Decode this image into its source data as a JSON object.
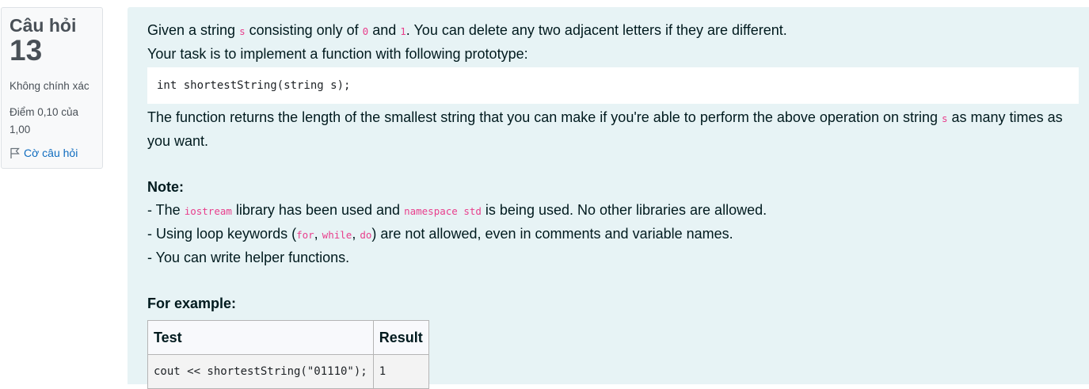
{
  "question_info": {
    "label": "Câu hỏi",
    "number": "13",
    "state": "Không chính xác",
    "grade": "Điểm 0,10 của 1,00",
    "flag_label": "Cờ câu hỏi",
    "flag_icon": "flag-icon"
  },
  "question_text": {
    "line1": {
      "t1": "Given a string ",
      "c1": "s",
      "t2": " consisting only of ",
      "c2": "0",
      "t3": " and ",
      "c3": "1",
      "t4": ". You can delete any two adjacent letters if they are different."
    },
    "line2": "Your task is to implement a function with following prototype:",
    "prototype": "int shortestString(string s);",
    "line3": {
      "t1": "The function returns the length of the smallest string that you can make if you're able to perform the above operation on string ",
      "c1": "s",
      "t2": " as many times as you want."
    },
    "note_title": "Note:",
    "note1": {
      "t1": "- The ",
      "c1": "iostream",
      "t2": " library has been used and ",
      "c2": "namespace std",
      "t3": " is being used. No other libraries are allowed."
    },
    "note2": {
      "t1": "- Using loop keywords (",
      "c1": "for",
      "t2": ", ",
      "c2": "while",
      "t3": ", ",
      "c3": "do",
      "t4": ") are not allowed, even in comments and variable names."
    },
    "note3": "- You can write helper functions.",
    "example_title": "For example:",
    "table": {
      "headers": [
        "Test",
        "Result"
      ],
      "rows": [
        [
          "cout << shortestString(\"01110\");",
          "1"
        ]
      ]
    }
  },
  "colors": {
    "content_bg": "#e7f3f5",
    "code_inline": "#e83e8c",
    "link": "#0f6cbf"
  }
}
